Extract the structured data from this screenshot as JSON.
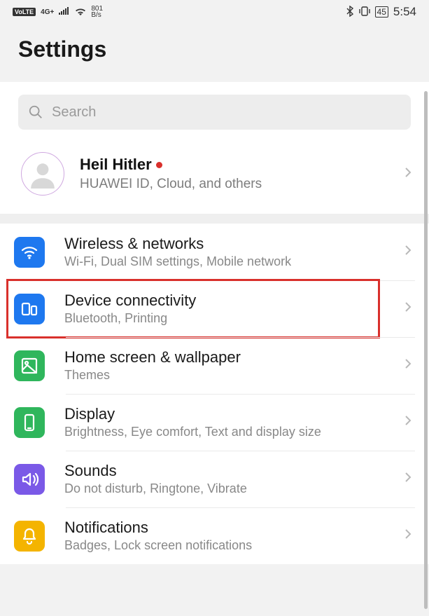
{
  "status": {
    "volte": "VoLTE",
    "net": "4G+",
    "speed_top": "801",
    "speed_bot": "B/s",
    "battery": "45",
    "time": "5:54"
  },
  "title": "Settings",
  "search": {
    "placeholder": "Search"
  },
  "account": {
    "name": "Heil Hitler",
    "sub": "HUAWEI ID, Cloud, and others"
  },
  "items": [
    {
      "title": "Wireless & networks",
      "sub": "Wi-Fi, Dual SIM settings, Mobile network",
      "icon": "wifi",
      "color": "#1e78ef"
    },
    {
      "title": "Device connectivity",
      "sub": "Bluetooth, Printing",
      "icon": "devices",
      "color": "#1e78ef",
      "highlighted": true
    },
    {
      "title": "Home screen & wallpaper",
      "sub": "Themes",
      "icon": "wallpaper",
      "color": "#2fb65c"
    },
    {
      "title": "Display",
      "sub": "Brightness, Eye comfort, Text and display size",
      "icon": "display",
      "color": "#2fb65c"
    },
    {
      "title": "Sounds",
      "sub": "Do not disturb, Ringtone, Vibrate",
      "icon": "sound",
      "color": "#7a59e7"
    },
    {
      "title": "Notifications",
      "sub": "Badges, Lock screen notifications",
      "icon": "bell",
      "color": "#f4b400"
    }
  ]
}
